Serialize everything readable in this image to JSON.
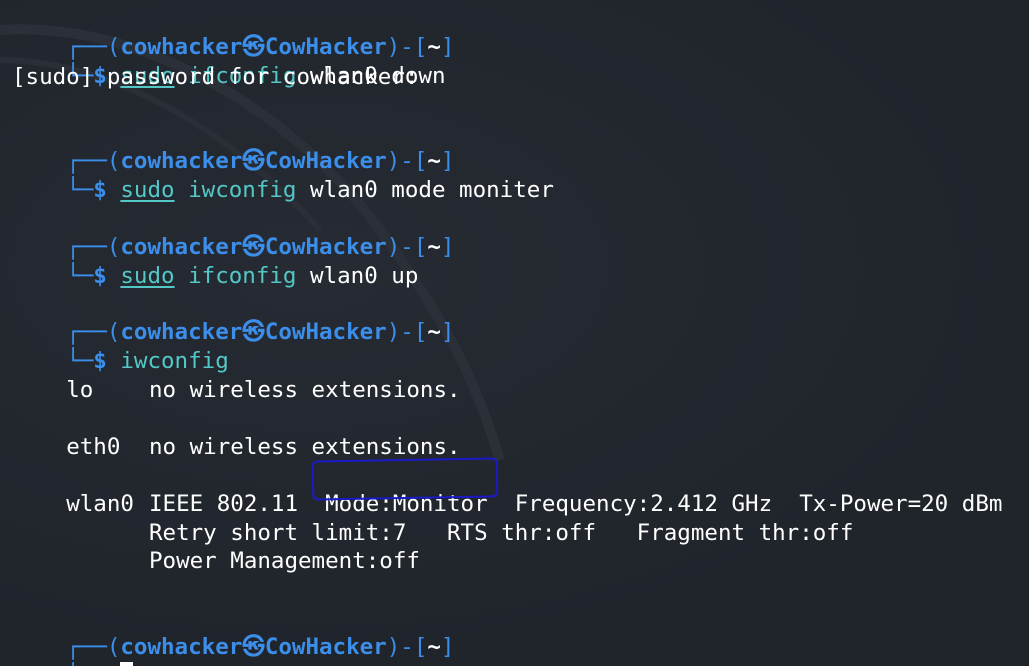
{
  "prompt": {
    "user": "cowhacker",
    "skull_glyph": "㉿",
    "host": "CowHacker",
    "dir": "~",
    "dollar": "$"
  },
  "blocks": [
    {
      "sudo": "sudo",
      "exec": "ifconfig",
      "args": "wlan0 down",
      "output": [
        "[sudo] password for cowhacker:"
      ]
    },
    {
      "sudo": "sudo",
      "exec": "iwconfig",
      "args": "wlan0 mode moniter",
      "output": []
    },
    {
      "sudo": "sudo",
      "exec": "ifconfig",
      "args": "wlan0 up",
      "output": []
    },
    {
      "sudo": "",
      "exec": "iwconfig",
      "args": "",
      "output": []
    }
  ],
  "iwconfig_output": {
    "lo": {
      "iface": "lo",
      "text": "no wireless extensions."
    },
    "eth0": {
      "iface": "eth0",
      "text": "no wireless extensions."
    },
    "wlan0": {
      "iface": "wlan0",
      "line1": "IEEE 802.11  Mode:Monitor  Frequency:2.412 GHz  Tx-Power=20 dBm",
      "line2": "Retry short limit:7   RTS thr:off   Fragment thr:off",
      "line3": "Power Management:off"
    }
  },
  "annotation": {
    "circled_text": "Mode:Monitor",
    "color": "#1a1ac8"
  },
  "colors": {
    "background": "#232830",
    "prompt_blue": "#3b8eea",
    "command_cyan": "#54c7c7"
  }
}
